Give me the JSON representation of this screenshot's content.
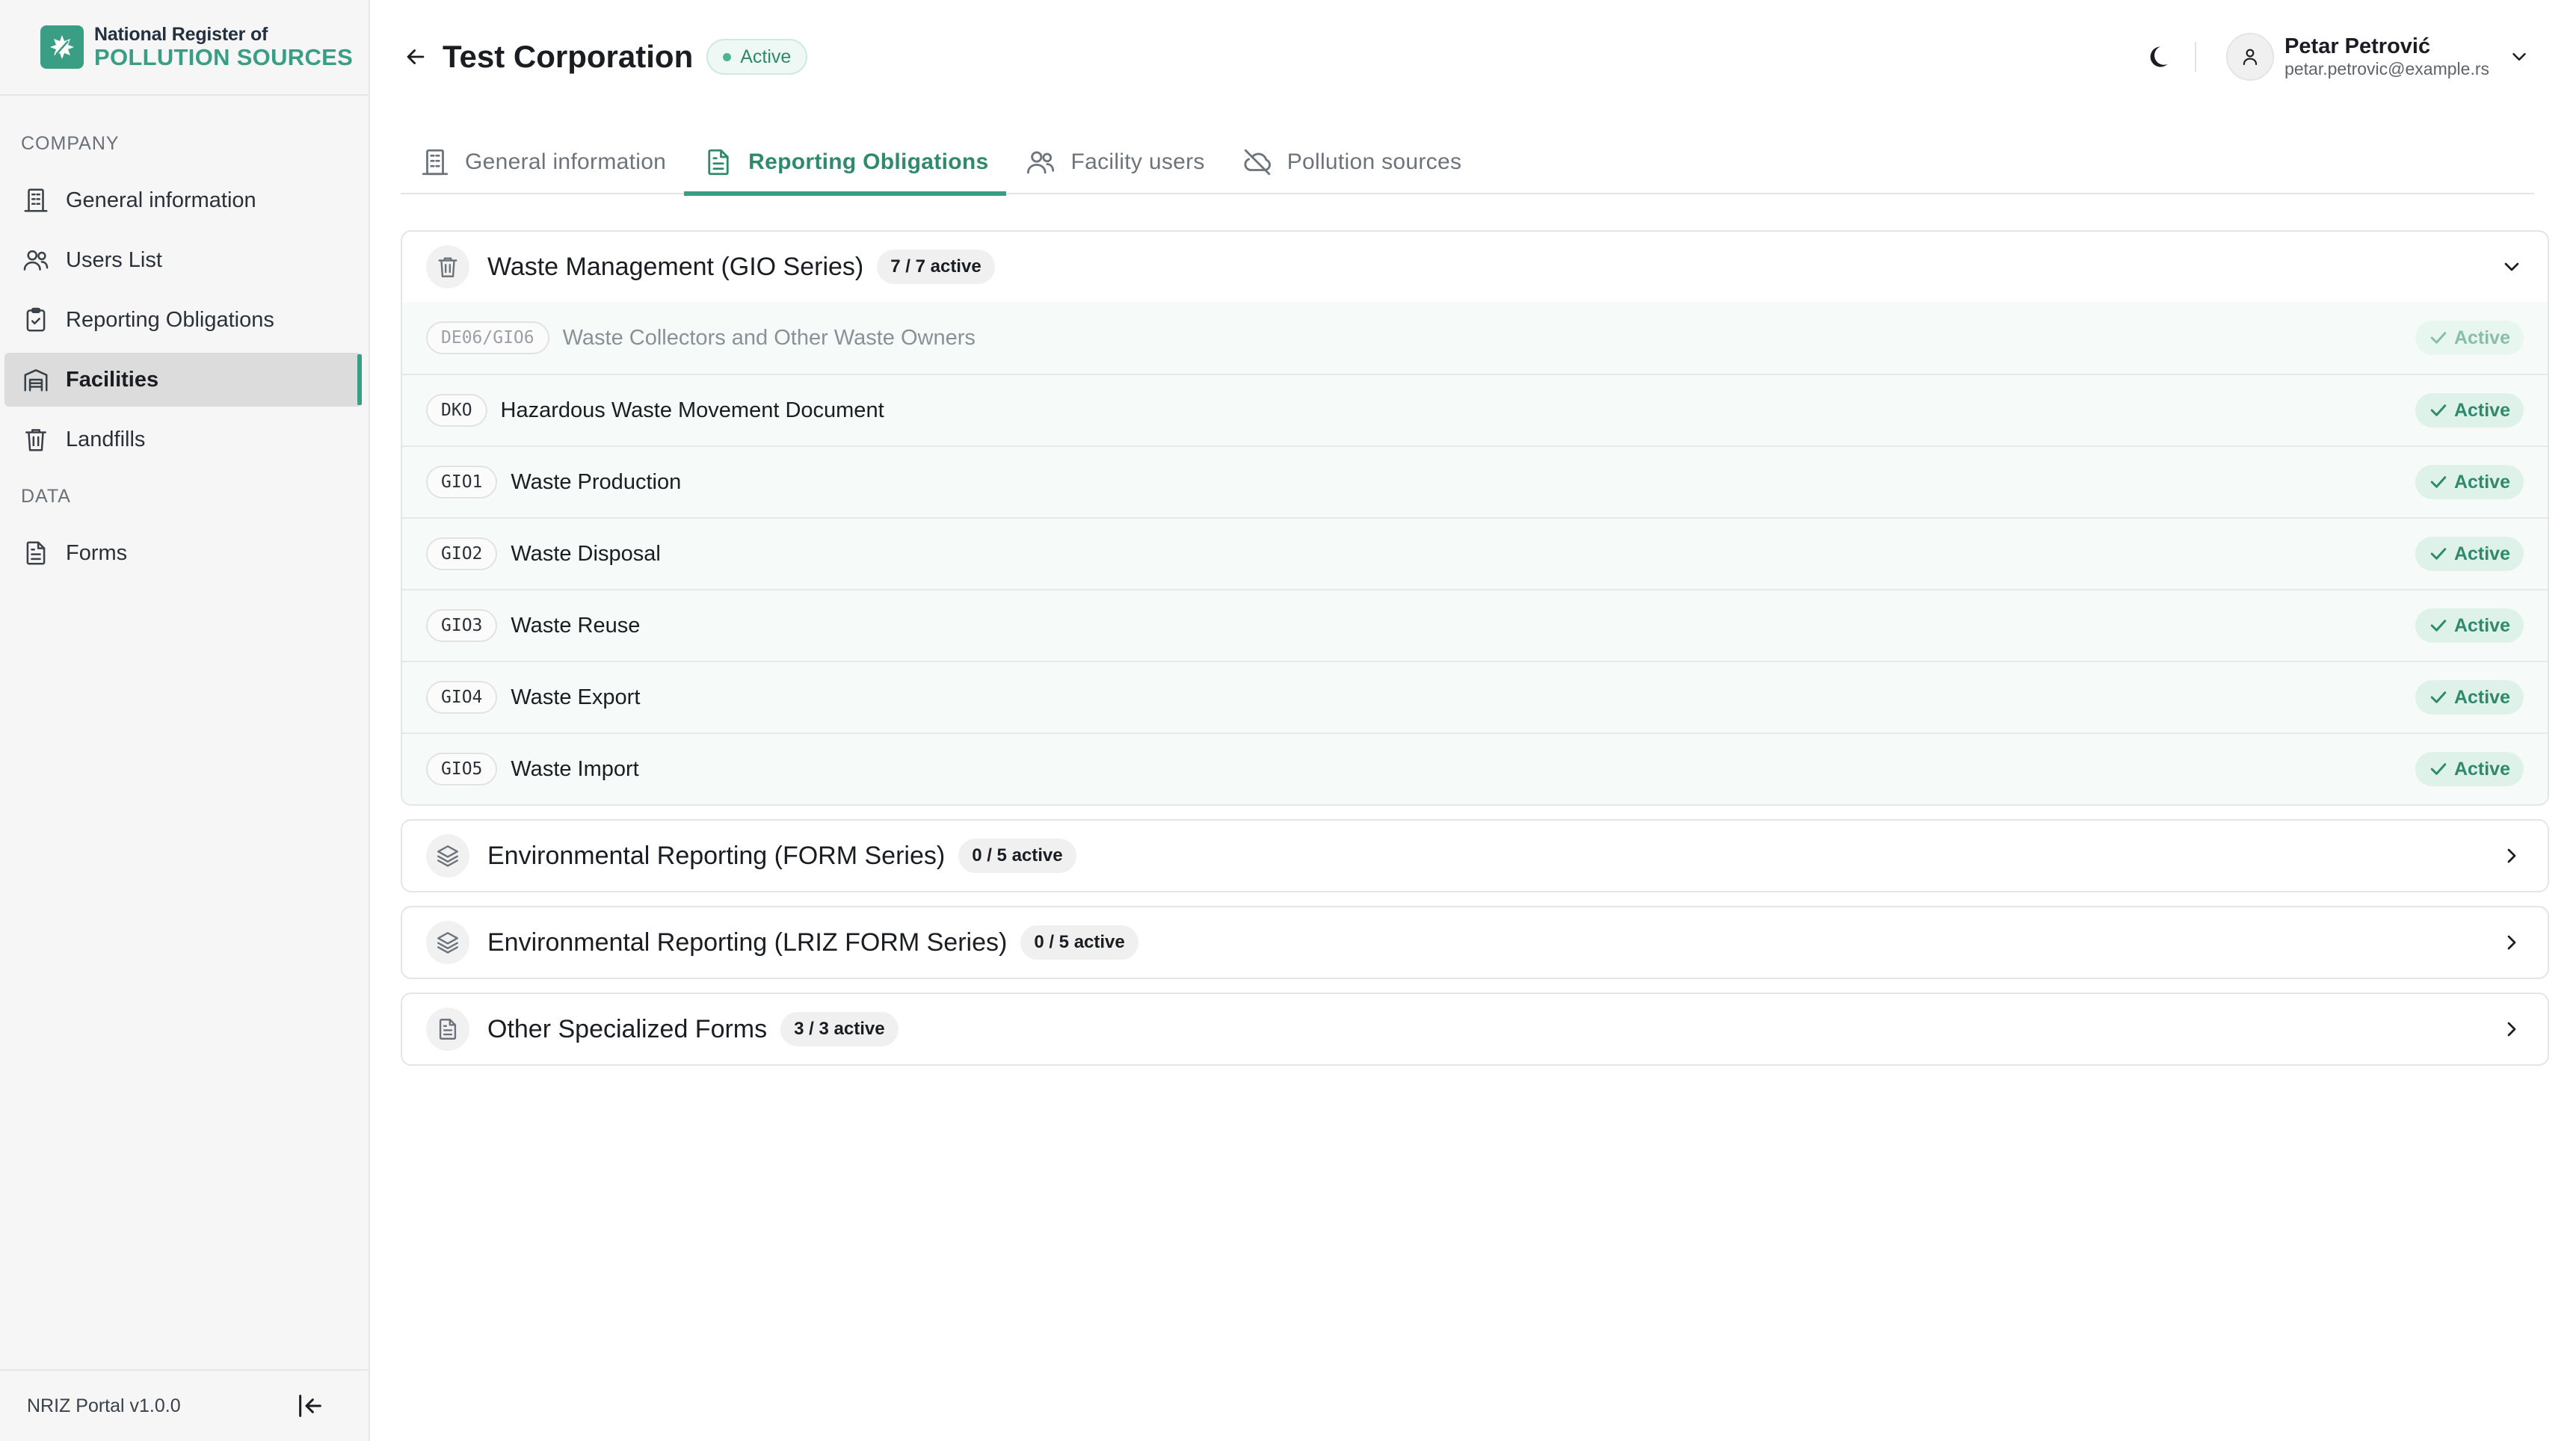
{
  "brand": {
    "line1": "National Register of",
    "line2": "POLLUTION SOURCES"
  },
  "sidebar": {
    "sections": [
      {
        "label": "COMPANY"
      },
      {
        "label": "DATA"
      }
    ],
    "items": [
      {
        "label": "General information",
        "icon": "building-icon"
      },
      {
        "label": "Users List",
        "icon": "users-icon"
      },
      {
        "label": "Reporting Obligations",
        "icon": "clipboard-check-icon"
      },
      {
        "label": "Facilities",
        "icon": "warehouse-icon",
        "active": true
      },
      {
        "label": "Landfills",
        "icon": "trash-icon"
      },
      {
        "label": "Forms",
        "icon": "document-icon"
      }
    ],
    "version": "NRIZ Portal v1.0.0"
  },
  "header": {
    "title": "Test Corporation",
    "status": "Active",
    "user_name": "Petar Petrović",
    "user_email": "petar.petrovic@example.rs"
  },
  "tabs": [
    {
      "label": "General information",
      "icon": "building-icon"
    },
    {
      "label": "Reporting Obligations",
      "icon": "document-icon",
      "active": true
    },
    {
      "label": "Facility users",
      "icon": "users-icon"
    },
    {
      "label": "Pollution sources",
      "icon": "cloud-off-icon"
    }
  ],
  "groups": [
    {
      "title": "Waste Management (GIO Series)",
      "count": "7 / 7 active",
      "icon": "trash-icon",
      "expanded": true,
      "rows": [
        {
          "code": "DE06/GIO6",
          "label": "Waste Collectors and Other Waste Owners",
          "status": "Active",
          "dim": true
        },
        {
          "code": "DKO",
          "label": "Hazardous Waste Movement Document",
          "status": "Active"
        },
        {
          "code": "GIO1",
          "label": "Waste Production",
          "status": "Active"
        },
        {
          "code": "GIO2",
          "label": "Waste Disposal",
          "status": "Active"
        },
        {
          "code": "GIO3",
          "label": "Waste Reuse",
          "status": "Active"
        },
        {
          "code": "GIO4",
          "label": "Waste Export",
          "status": "Active"
        },
        {
          "code": "GIO5",
          "label": "Waste Import",
          "status": "Active"
        }
      ]
    },
    {
      "title": "Environmental Reporting (FORM Series)",
      "count": "0 / 5 active",
      "icon": "layers-icon",
      "expanded": false
    },
    {
      "title": "Environmental Reporting (LRIZ FORM Series)",
      "count": "0 / 5 active",
      "icon": "layers-icon",
      "expanded": false
    },
    {
      "title": "Other Specialized Forms",
      "count": "3 / 3 active",
      "icon": "document-icon",
      "expanded": false
    }
  ],
  "colors": {
    "accent": "#3a9e85",
    "active_text": "#2f8a6d",
    "active_bg": "#def2e9"
  }
}
